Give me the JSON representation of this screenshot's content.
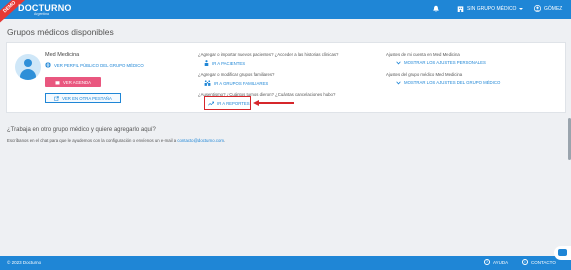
{
  "header": {
    "ribbon": "DEMO",
    "logo": "DOCTURNO",
    "logo_sub": "Argentina",
    "group_label": "SIN GRUPO MÉDICO",
    "user_label": "GÓMEZ",
    "icons": [
      "bell-icon",
      "building-icon",
      "user-icon"
    ]
  },
  "page": {
    "title": "Grupos médicos disponibles"
  },
  "group": {
    "name": "Med Medicina",
    "profile_link": "VER PERFIL PÚBLICO DEL GRUPO MÉDICO",
    "agenda_button": "VER AGENDA",
    "new_tab_button": "VER EN OTRA PESTAÑA"
  },
  "actions": {
    "q1": "¿Agregar o importar nuevos pacientes? ¿Acceder a las historias clínicas?",
    "a1": "IR A PACIENTES",
    "q2": "¿Agregar o modificar grupos familiares?",
    "a2": "IR A GRUPOS FAMILIARES",
    "q3": "¿Ausentismo? ¿Cuántos turnos dieron? ¿Cuántas cancelaciones hubo?",
    "a3": "IR A REPORTES"
  },
  "settings": {
    "q1": "Ajustes de mi cuenta en Med Medicina",
    "a1": "MOSTRAR LOS AJUSTES PERSONALES",
    "q2": "Ajustes del grupo médico Med Medicina",
    "a2": "MOSTRAR LOS AJUSTES DEL GRUPO MÉDICO"
  },
  "invite": {
    "title": "¿Trabaja en otro grupo médico y quiere agregarlo aquí?",
    "text": "Escríbanos en el chat para que le ayudemos con la configuración o envíenos un e-mail a",
    "email": "contacto@docturno.com",
    "end": "."
  },
  "footer": {
    "copyright": "© 2023 Docturno",
    "help": "AYUDA",
    "contact": "CONTACTO"
  },
  "colors": {
    "primary": "#1f86d6",
    "agenda": "#e9577f",
    "highlight": "#d6262b"
  }
}
